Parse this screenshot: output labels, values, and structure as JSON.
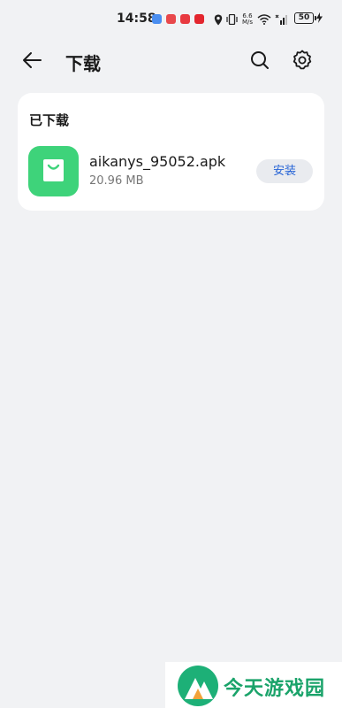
{
  "status_bar": {
    "time": "14:58",
    "net_speed": "6.6\nM/s",
    "battery": "50"
  },
  "header": {
    "title": "下载"
  },
  "downloaded_section": {
    "title": "已下载",
    "files": [
      {
        "name": "aikanys_95052.apk",
        "size": "20.96 MB",
        "action_label": "安装"
      }
    ]
  },
  "watermark": {
    "text": "今天游戏园"
  },
  "colors": {
    "background": "#f1f2f4",
    "card": "#ffffff",
    "app_icon": "#3ed37a",
    "accent_blue": "#2563d6",
    "watermark_green": "#1aa36a"
  }
}
